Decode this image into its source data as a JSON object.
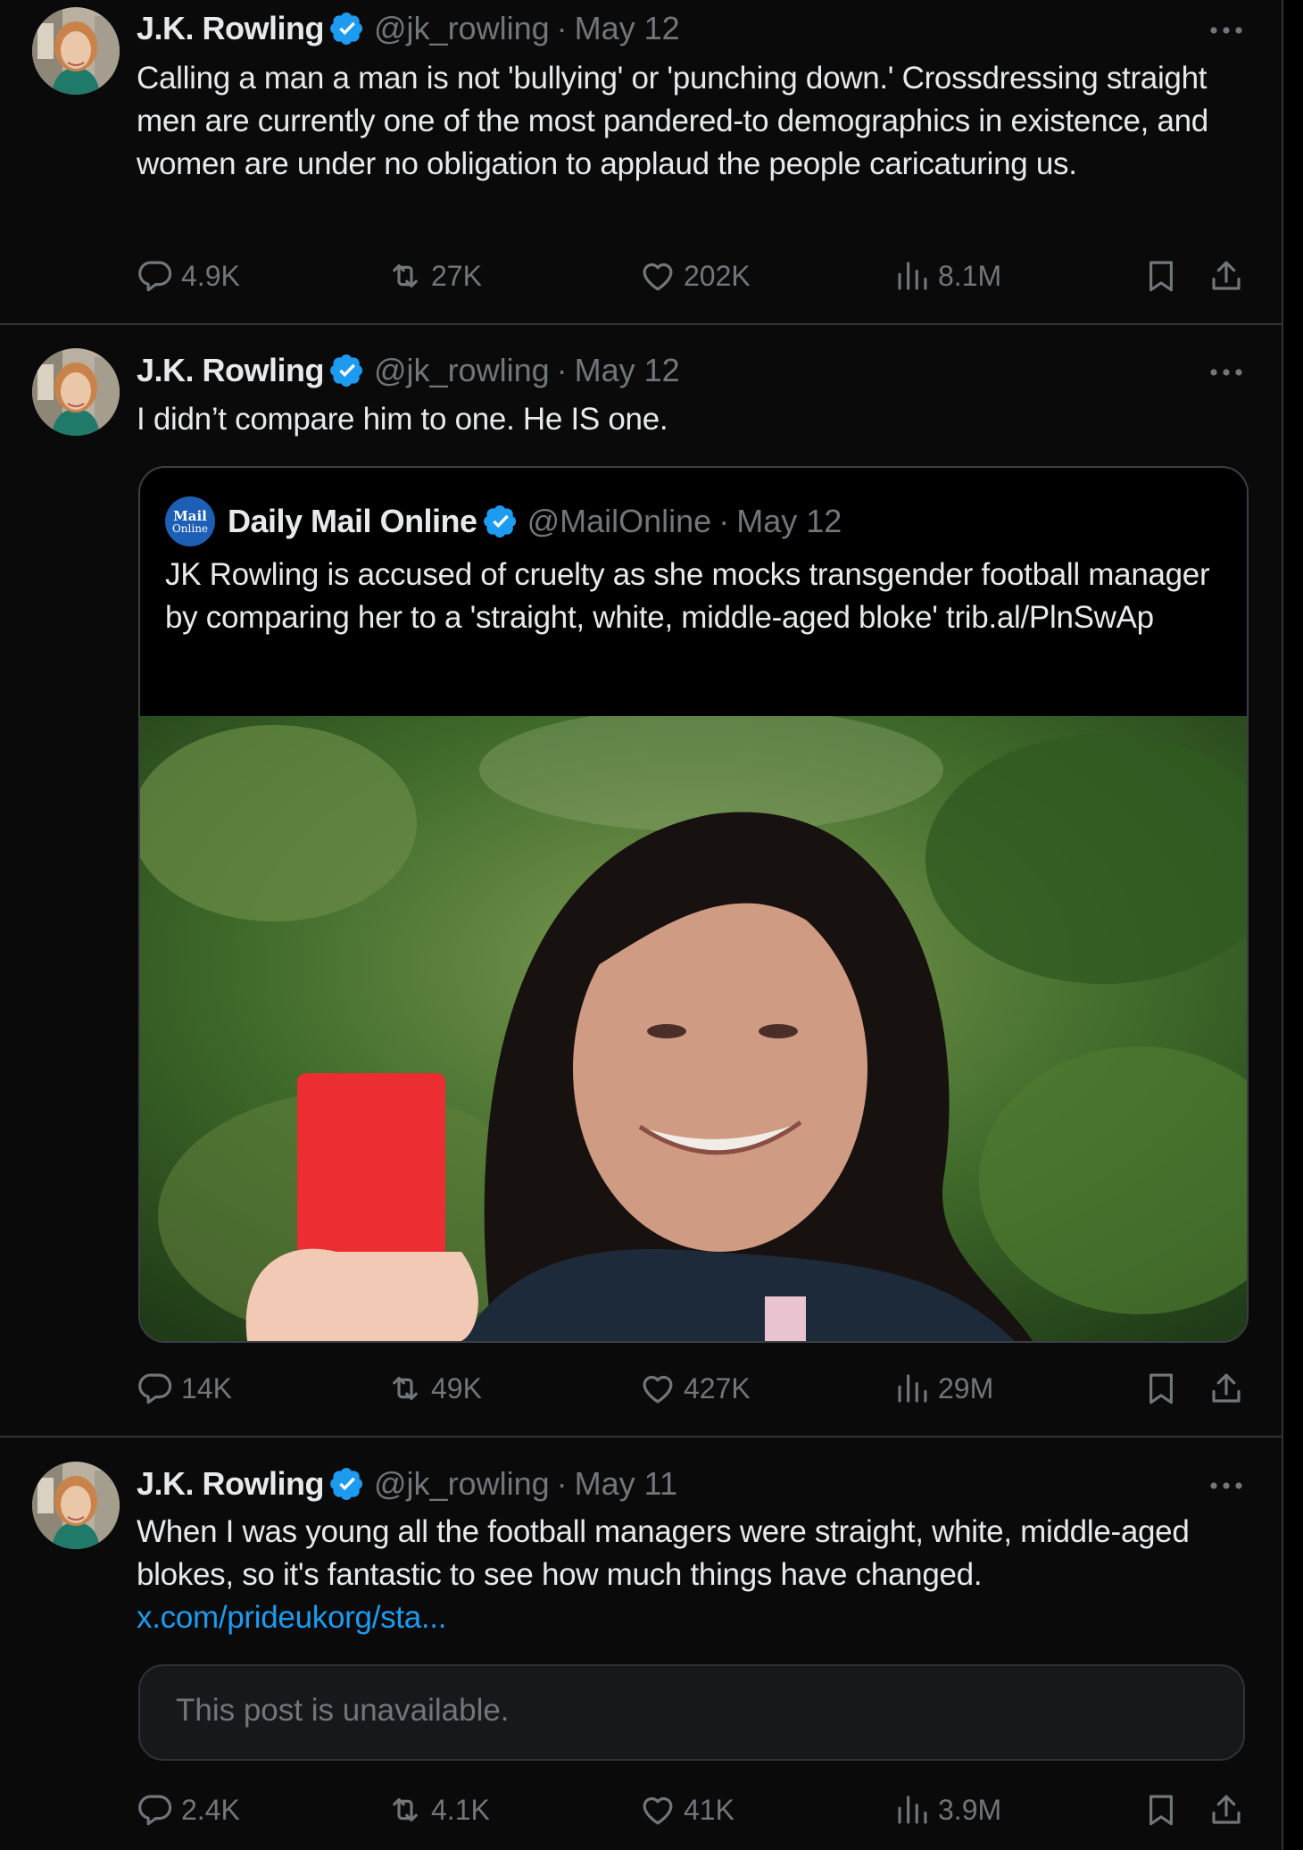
{
  "colors": {
    "background": "#0a0a0b",
    "text": "#e7e9ea",
    "muted": "#71767b",
    "verified": "#1d9bf0",
    "link": "#1d9bf0",
    "border": "#2f3336"
  },
  "tweets": [
    {
      "author": "J.K. Rowling",
      "handle": "@jk_rowling",
      "separator": "·",
      "date": "May 12",
      "text": "Calling a man a man is not 'bullying' or 'punching down.' Crossdressing straight men are currently one of the most pandered-to demographics in existence, and women are under no obligation to applaud the people caricaturing us.",
      "stats": {
        "replies": "4.9K",
        "reposts": "27K",
        "likes": "202K",
        "views": "8.1M"
      }
    },
    {
      "author": "J.K. Rowling",
      "handle": "@jk_rowling",
      "separator": "·",
      "date": "May 12",
      "text": "I didn’t compare him to one. He IS one.",
      "quote": {
        "logo_line1": "Mail",
        "logo_line2": "Online",
        "author": "Daily Mail Online",
        "handle": "@MailOnline",
        "separator": "·",
        "date": "May 12",
        "text": "JK Rowling is accused of cruelty as she mocks transgender football manager by comparing her to a 'straight, white, middle-aged bloke' trib.al/PlnSwAp"
      },
      "stats": {
        "replies": "14K",
        "reposts": "49K",
        "likes": "427K",
        "views": "29M"
      }
    },
    {
      "author": "J.K. Rowling",
      "handle": "@jk_rowling",
      "separator": "·",
      "date": "May 11",
      "text": "When I was young all the football managers were straight, white, middle-aged blokes, so it's fantastic to see how much things have changed.",
      "link": "x.com/prideukorg/sta...",
      "unavailable": "This post is unavailable.",
      "stats": {
        "replies": "2.4K",
        "reposts": "4.1K",
        "likes": "41K",
        "views": "3.9M"
      }
    }
  ]
}
